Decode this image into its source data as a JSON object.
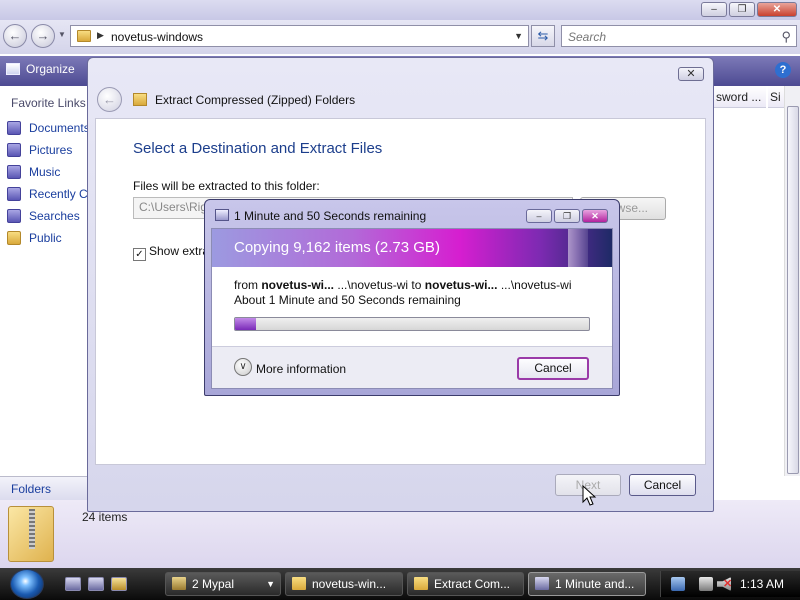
{
  "explorer": {
    "address": "novetus-windows",
    "search_placeholder": "Search",
    "organize_label": "Organize",
    "favorite_links_title": "Favorite Links",
    "favorites": [
      {
        "label": "Documents",
        "icon": "documents-icon"
      },
      {
        "label": "Pictures",
        "icon": "pictures-icon"
      },
      {
        "label": "Music",
        "icon": "music-icon"
      },
      {
        "label": "Recently Changed",
        "icon": "recent-icon"
      },
      {
        "label": "Searches",
        "icon": "searches-icon"
      },
      {
        "label": "Public",
        "icon": "folder-icon"
      }
    ],
    "column_headers": [
      "sword ...",
      "Si"
    ],
    "folders_label": "Folders",
    "item_count": "24 items"
  },
  "wizard": {
    "title": "Extract Compressed (Zipped) Folders",
    "heading": "Select a Destination and Extract Files",
    "folder_label": "Files will be extracted to this folder:",
    "path_value": "C:\\Users\\Rig",
    "browse_label": "Browse...",
    "show_label": "Show extracted files when complete",
    "show_checked": true,
    "next_label": "Next",
    "cancel_label": "Cancel"
  },
  "copy_dialog": {
    "title": "1 Minute and 50 Seconds remaining",
    "banner": "Copying 9,162 items (2.73 GB)",
    "from_word": "from",
    "from_name": "novetus-wi...",
    "from_path": "...\\novetus-wi",
    "to_word": "to",
    "to_name": "novetus-wi...",
    "to_path": "...\\novetus-wi",
    "remaining": "About 1 Minute and 50 Seconds remaining",
    "progress_fraction": 0.06,
    "more_info_label": "More information",
    "cancel_label": "Cancel"
  },
  "taskbar": {
    "tasks": [
      {
        "label": "2 Mypal",
        "icon": "mypal-icon",
        "active": false
      },
      {
        "label": "novetus-win...",
        "icon": "folder-icon",
        "active": false
      },
      {
        "label": "Extract Com...",
        "icon": "folder-icon",
        "active": false
      },
      {
        "label": "1 Minute and...",
        "icon": "copy-icon",
        "active": true
      }
    ],
    "clock": "1:13 AM"
  },
  "colors": {
    "accent": "#4d4a92",
    "heading_blue": "#1c3e8c",
    "link_blue": "#1a3e9e",
    "progress_purple": "#7a2ab8",
    "banner_magenta": "#d61ed0"
  }
}
